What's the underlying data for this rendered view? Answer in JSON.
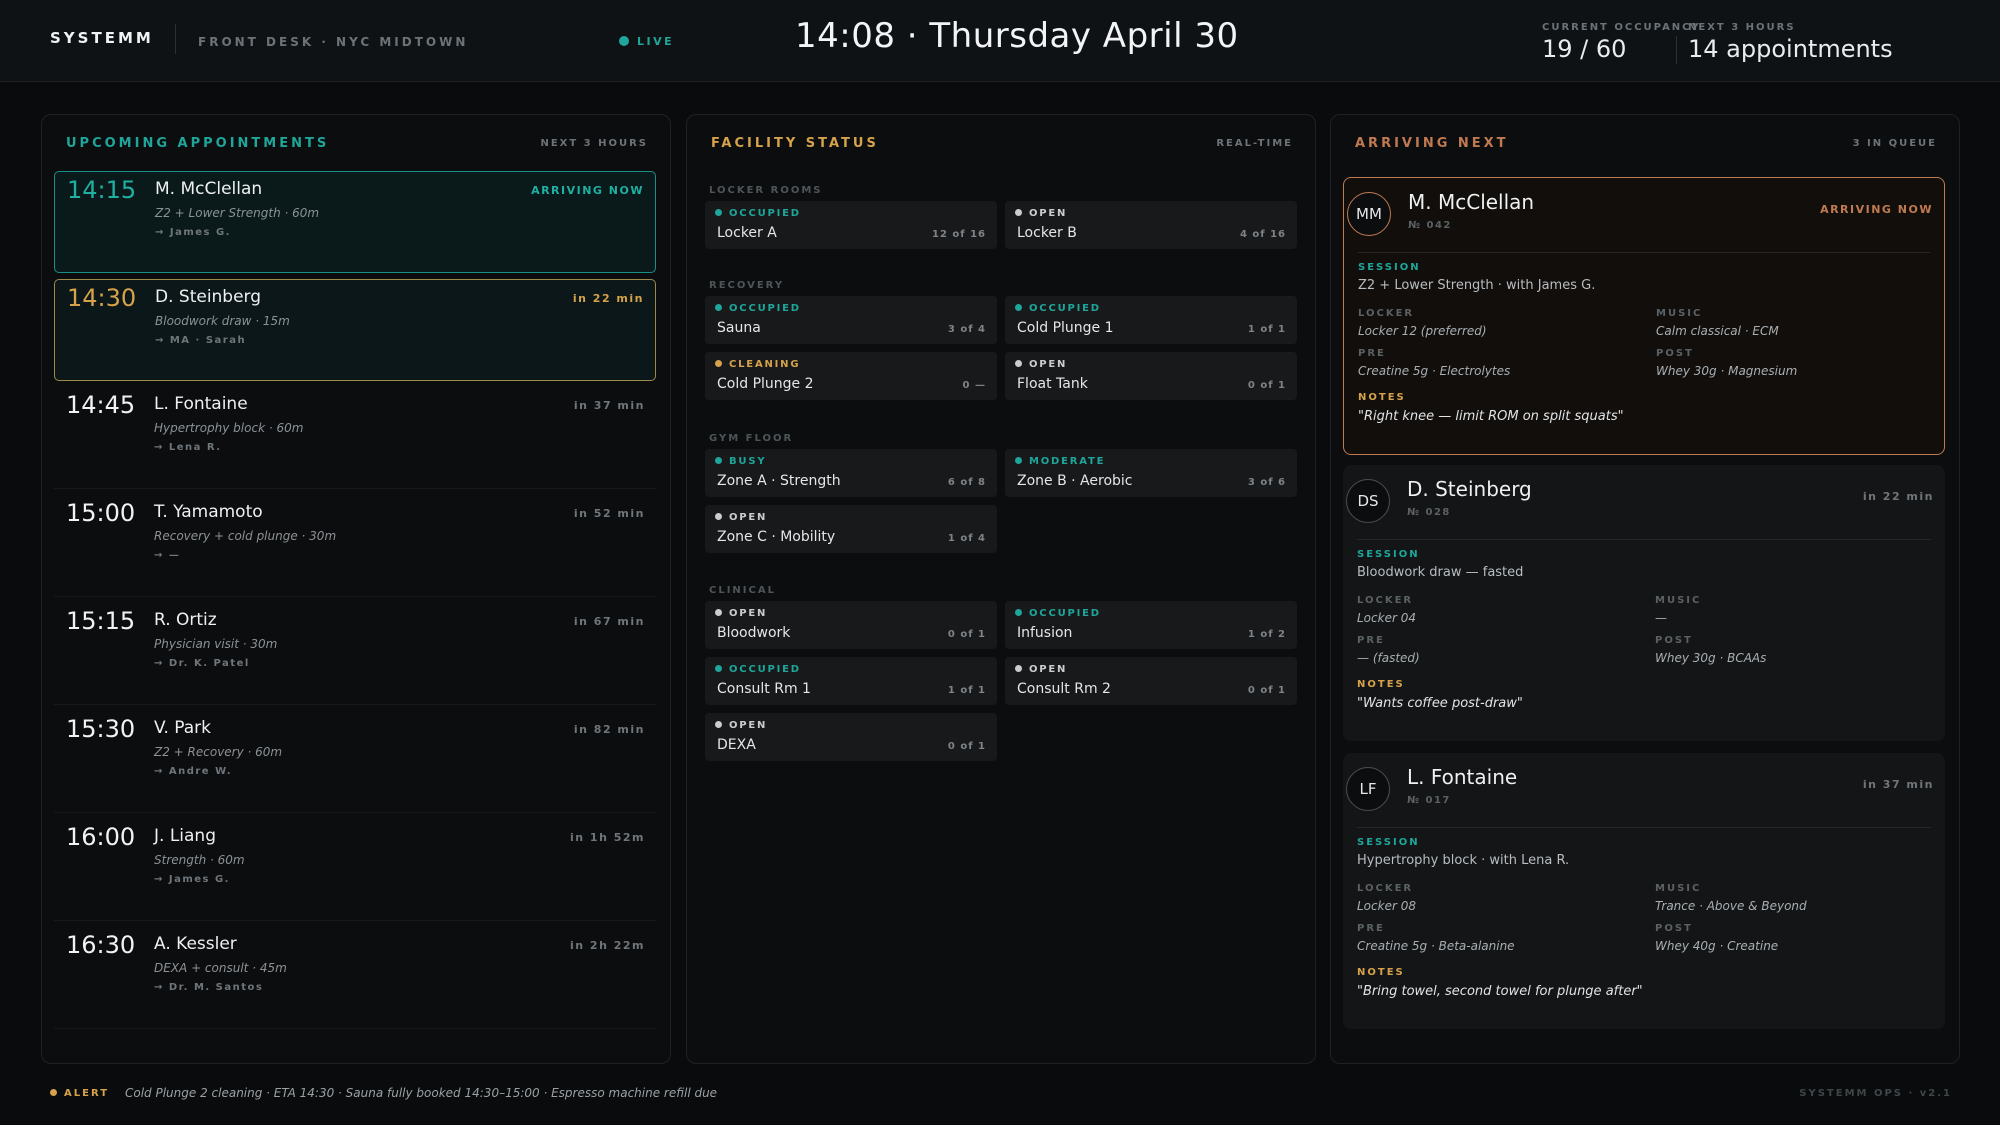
{
  "header": {
    "logo": "SYSTEMM",
    "location": "FRONT DESK · NYC MIDTOWN",
    "live": "LIVE",
    "clock": "14:08 · Thursday April 30",
    "occupancy_label": "CURRENT OCCUPANCY",
    "occupancy_value": "19 / 60",
    "next_label": "NEXT 3 HOURS",
    "next_value": "14 appointments"
  },
  "upcoming": {
    "title": "UPCOMING APPOINTMENTS",
    "side": "NEXT 3 HOURS",
    "items": [
      {
        "time": "14:15",
        "name": "M. McClellan",
        "session": "Z2 + Lower Strength · 60m",
        "coach": "→ James G.",
        "eta": "ARRIVING NOW",
        "time_color": "#1fb0a3",
        "eta_color": "#1fb0a3"
      },
      {
        "time": "14:30",
        "name": "D. Steinberg",
        "session": "Bloodwork draw · 15m",
        "coach": "→ MA · Sarah",
        "eta": "in 22 min",
        "time_color": "#d6a24a",
        "eta_color": "#d6a24a"
      },
      {
        "time": "14:45",
        "name": "L. Fontaine",
        "session": "Hypertrophy block · 60m",
        "coach": "→ Lena R.",
        "eta": "in 37 min"
      },
      {
        "time": "15:00",
        "name": "T. Yamamoto",
        "session": "Recovery + cold plunge · 30m",
        "coach": "→ —",
        "eta": "in 52 min"
      },
      {
        "time": "15:15",
        "name": "R. Ortiz",
        "session": "Physician visit · 30m",
        "coach": "→ Dr. K. Patel",
        "eta": "in 67 min"
      },
      {
        "time": "15:30",
        "name": "V. Park",
        "session": "Z2 + Recovery · 60m",
        "coach": "→ Andre W.",
        "eta": "in 82 min"
      },
      {
        "time": "16:00",
        "name": "J. Liang",
        "session": "Strength · 60m",
        "coach": "→ James G.",
        "eta": "in 1h 52m"
      },
      {
        "time": "16:30",
        "name": "A. Kessler",
        "session": "DEXA + consult · 45m",
        "coach": "→ Dr. M. Santos",
        "eta": "in 2h 22m"
      }
    ]
  },
  "facility": {
    "title": "FACILITY STATUS",
    "side": "REAL-TIME",
    "sections": [
      {
        "label": "LOCKER ROOMS",
        "tiles": [
          {
            "status": "OCCUPIED",
            "name": "Locker A",
            "count": "12 of 16",
            "color": "#1fa69a"
          },
          {
            "status": "OPEN",
            "name": "Locker B",
            "count": "4 of 16",
            "color": "#c9cdd0"
          }
        ]
      },
      {
        "label": "RECOVERY",
        "tiles": [
          {
            "status": "OCCUPIED",
            "name": "Sauna",
            "count": "3 of 4",
            "color": "#1fa69a"
          },
          {
            "status": "OCCUPIED",
            "name": "Cold Plunge 1",
            "count": "1 of 1",
            "color": "#1fa69a"
          },
          {
            "status": "CLEANING",
            "name": "Cold Plunge 2",
            "count": "0 —",
            "color": "#d6a24a"
          },
          {
            "status": "OPEN",
            "name": "Float Tank",
            "count": "0 of 1",
            "color": "#c9cdd0"
          }
        ]
      },
      {
        "label": "GYM FLOOR",
        "tiles": [
          {
            "status": "BUSY",
            "name": "Zone A · Strength",
            "count": "6 of 8",
            "color": "#1fa69a"
          },
          {
            "status": "MODERATE",
            "name": "Zone B · Aerobic",
            "count": "3 of 6",
            "color": "#1fa69a"
          },
          {
            "status": "OPEN",
            "name": "Zone C · Mobility",
            "count": "1 of 4",
            "color": "#c9cdd0"
          }
        ]
      },
      {
        "label": "CLINICAL",
        "tiles": [
          {
            "status": "OPEN",
            "name": "Bloodwork",
            "count": "0 of 1",
            "color": "#c9cdd0"
          },
          {
            "status": "OCCUPIED",
            "name": "Infusion",
            "count": "1 of 2",
            "color": "#1fa69a"
          },
          {
            "status": "OCCUPIED",
            "name": "Consult Rm 1",
            "count": "1 of 1",
            "color": "#1fa69a"
          },
          {
            "status": "OPEN",
            "name": "Consult Rm 2",
            "count": "0 of 1",
            "color": "#c9cdd0"
          },
          {
            "status": "OPEN",
            "name": "DEXA",
            "count": "0 of 1",
            "color": "#c9cdd0"
          }
        ]
      }
    ]
  },
  "arriving": {
    "title": "ARRIVING NEXT",
    "side": "3 IN QUEUE",
    "labels": {
      "session": "SESSION",
      "locker": "LOCKER",
      "music": "MUSIC",
      "pre": "PRE",
      "post": "POST",
      "notes": "NOTES"
    },
    "cards": [
      {
        "initials": "MM",
        "name": "M. McClellan",
        "id": "№ 042",
        "eta": "ARRIVING NOW",
        "eta_color": "#c07a52",
        "session": "Z2 + Lower Strength · with James G.",
        "locker": "Locker 12 (preferred)",
        "music": "Calm classical · ECM",
        "pre": "Creatine 5g · Electrolytes",
        "post": "Whey 30g · Magnesium",
        "notes": "\"Right knee — limit ROM on split squats\""
      },
      {
        "initials": "DS",
        "name": "D. Steinberg",
        "id": "№ 028",
        "eta": "in 22 min",
        "session": "Bloodwork draw — fasted",
        "locker": "Locker 04",
        "music": "—",
        "pre": "— (fasted)",
        "post": "Whey 30g · BCAAs",
        "notes": "\"Wants coffee post-draw\""
      },
      {
        "initials": "LF",
        "name": "L. Fontaine",
        "id": "№ 017",
        "eta": "in 37 min",
        "session": "Hypertrophy block · with Lena R.",
        "locker": "Locker 08",
        "music": "Trance · Above & Beyond",
        "pre": "Creatine 5g · Beta-alanine",
        "post": "Whey 40g · Creatine",
        "notes": "\"Bring towel, second towel for plunge after\""
      }
    ]
  },
  "footer": {
    "alert_label": "ALERT",
    "alert_text": "Cold Plunge 2 cleaning · ETA 14:30 · Sauna fully booked 14:30–15:00 · Espresso machine refill due",
    "version": "SYSTEMM OPS · v2.1"
  },
  "colors": {
    "teal": "#1fa69a",
    "gold": "#d6a24a",
    "copper": "#c07a52",
    "background": "#0a0b0c"
  }
}
